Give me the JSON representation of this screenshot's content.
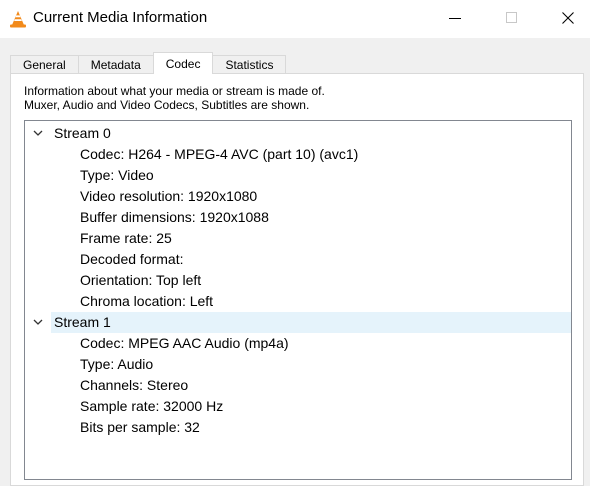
{
  "window": {
    "title": "Current Media Information",
    "controls": {
      "minimize": "—",
      "maximize": "☐",
      "close": "✕"
    }
  },
  "tabs": [
    {
      "label": "General",
      "active": false
    },
    {
      "label": "Metadata",
      "active": false
    },
    {
      "label": "Codec",
      "active": true
    },
    {
      "label": "Statistics",
      "active": false
    }
  ],
  "codec": {
    "description_line1": "Information about what your media or stream is made of.",
    "description_line2": "Muxer, Audio and Video Codecs, Subtitles are shown.",
    "streams": [
      {
        "label": "Stream 0",
        "expanded": true,
        "items": [
          "Codec: H264 - MPEG-4 AVC (part 10) (avc1)",
          "Type: Video",
          "Video resolution: 1920x1080",
          "Buffer dimensions: 1920x1088",
          "Frame rate: 25",
          "Decoded format:",
          "Orientation: Top left",
          "Chroma location: Left"
        ]
      },
      {
        "label": "Stream 1",
        "expanded": true,
        "highlighted": true,
        "items": [
          "Codec: MPEG AAC Audio (mp4a)",
          "Type: Audio",
          "Channels: Stereo",
          "Sample rate: 32000 Hz",
          "Bits per sample: 32"
        ]
      }
    ]
  },
  "colors": {
    "dialog_bg": "#f0f0f0",
    "tree_border": "#828790",
    "hover_row": "#e5f3fb",
    "vlc_orange": "#f28a1b"
  }
}
